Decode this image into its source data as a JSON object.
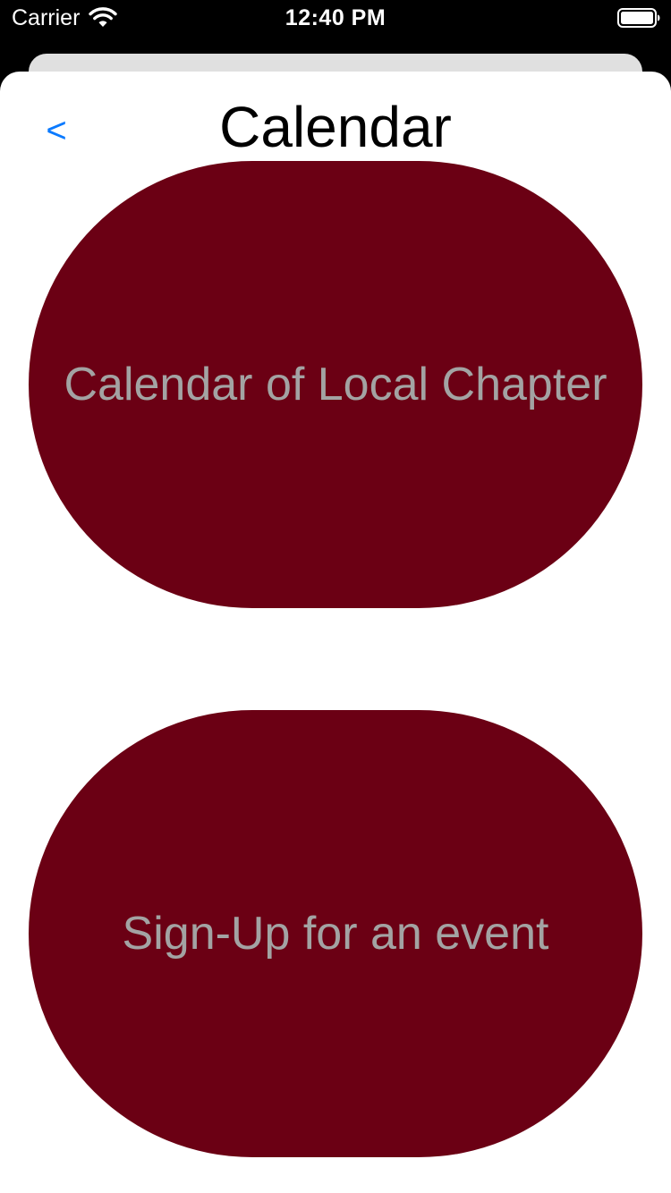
{
  "status_bar": {
    "carrier": "Carrier",
    "time": "12:40 PM",
    "wifi_icon": "wifi-icon",
    "battery_icon": "battery-icon"
  },
  "nav": {
    "back_label": "<",
    "title": "Calendar"
  },
  "buttons": {
    "calendar_label": "Calendar of Local Chapter",
    "signup_label": "Sign-Up for an event"
  },
  "colors": {
    "button_background": "#6b0014",
    "button_text": "#a3a3a3",
    "back_link": "#0a7aff"
  }
}
